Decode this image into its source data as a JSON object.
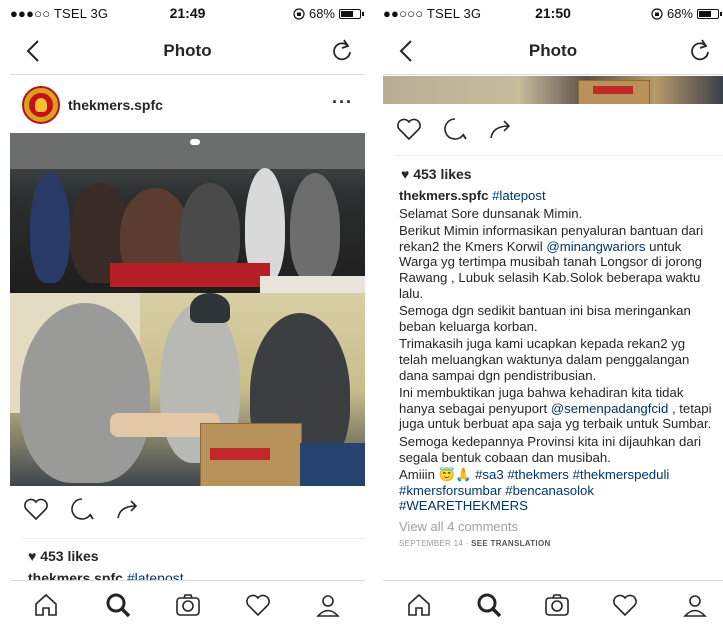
{
  "left": {
    "status": {
      "carrier": "●●●○○ TSEL  3G",
      "time": "21:49",
      "battery": "68%"
    },
    "nav": {
      "title": "Photo"
    },
    "post": {
      "username": "thekmers.spfc",
      "more": "···",
      "likes": "453 likes",
      "caption_user": "thekmers.spfc",
      "caption_tag": "#latepost"
    }
  },
  "right": {
    "status": {
      "carrier": "●●○○○ TSEL  3G",
      "time": "21:50",
      "battery": "68%"
    },
    "nav": {
      "title": "Photo"
    },
    "post": {
      "likes": "453 likes",
      "caption_user": "thekmers.spfc",
      "caption_tag": "#latepost",
      "paragraphs": [
        "Selamat Sore dunsanak Mimin.",
        "Semoga dgn sedikit bantuan ini bisa meringankan beban keluarga korban.",
        "Trimakasih juga kami ucapkan kepada rekan2 yg telah meluangkan waktunya dalam penggalangan dana sampai dgn pendistribusian.",
        "Semoga kedepannya Provinsi kita ini dijauhkan dari segala bentuk cobaan dan musibah."
      ],
      "p2_a": "Berikut Mimin informasikan penyaluran bantuan dari rekan2 the Kmers Korwil ",
      "p2_mention": "@minangwariors",
      "p2_b": " untuk Warga yg tertimpa musibah tanah Longsor di jorong Rawang , Lubuk selasih Kab.Solok beberapa waktu lalu.",
      "p5_a": "Ini membuktikan juga bahwa kehadiran kita tidak hanya sebagai penyuport ",
      "p5_mention": "@semenpadangfcid",
      "p5_b": " , tetapi juga untuk berbuat apa saja yg terbaik untuk Sumbar.",
      "amin": "Amiiin 😇🙏 ",
      "hashtags": "#sa3 #thekmers #thekmerspeduli #kmersforsumbar #bencanasolok #WEARETHEKMERS",
      "view_comments": "View all 4 comments",
      "date": "SEPTEMBER 14",
      "separator": " · ",
      "see_translation": "SEE TRANSLATION"
    }
  },
  "icons": {
    "back": "chevron-left-icon",
    "reload": "refresh-icon",
    "heart": "heart-icon",
    "comment": "comment-icon",
    "share": "share-icon",
    "home": "home-icon",
    "search": "search-icon",
    "camera": "camera-icon",
    "activity": "heart-icon",
    "profile": "profile-icon"
  },
  "colors": {
    "link": "#003569",
    "divider": "#dbdbdb",
    "text": "#262626"
  }
}
